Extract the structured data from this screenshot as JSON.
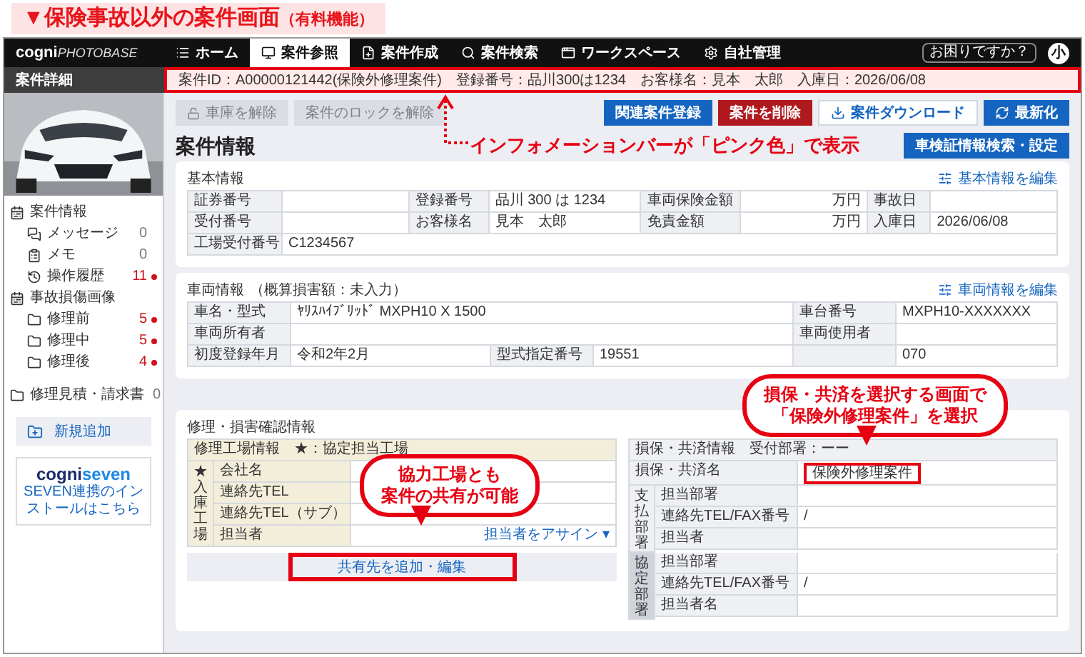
{
  "banner": {
    "title": "▼保険事故以外の案件画面",
    "note": "（有料機能）"
  },
  "header": {
    "logo_main": "cogni",
    "logo_sub": "PHOTOBASE",
    "nav": [
      {
        "label": "ホーム",
        "selected": false
      },
      {
        "label": "案件参照",
        "selected": true
      },
      {
        "label": "案件作成",
        "selected": false
      },
      {
        "label": "案件検索",
        "selected": false
      },
      {
        "label": "ワークスペース",
        "selected": false
      },
      {
        "label": "自社管理",
        "selected": false
      }
    ],
    "help_button": "お困りですか？",
    "avatar": "小"
  },
  "info_bar": {
    "text": "案件ID：A00000121442(保険外修理案件)　登録番号：品川300は1234　お客様名：見本　太郎　入庫日：2026/06/08"
  },
  "sidebar": {
    "title": "案件詳細",
    "menu": [
      {
        "label": "案件情報",
        "children": [
          {
            "label": "メッセージ",
            "count": "0",
            "alert": false
          },
          {
            "label": "メモ",
            "count": "0",
            "alert": false
          },
          {
            "label": "操作履歴",
            "count": "11",
            "alert": true
          }
        ]
      },
      {
        "label": "事故損傷画像",
        "children": [
          {
            "label": "修理前",
            "count": "5",
            "alert": true
          },
          {
            "label": "修理中",
            "count": "5",
            "alert": true
          },
          {
            "label": "修理後",
            "count": "4",
            "alert": true
          }
        ]
      },
      {
        "label": "修理見積・請求書",
        "count": "0",
        "alert": false
      }
    ],
    "add_button": "新規追加",
    "seven_logo_a": "cogni",
    "seven_logo_b": "seven",
    "seven_link": "SEVEN連携のインストールはこちら"
  },
  "toolbar": {
    "left": [
      {
        "label": "車庫を解除",
        "disabled": true
      },
      {
        "label": "案件のロックを解除",
        "disabled": true
      }
    ],
    "right": [
      {
        "label": "関連案件登録",
        "kind": "primary"
      },
      {
        "label": "案件を削除",
        "kind": "danger"
      },
      {
        "label": "案件ダウンロード",
        "kind": "outline"
      },
      {
        "label": "最新化",
        "kind": "refresh"
      }
    ]
  },
  "page_title": "案件情報",
  "title_button": "車検証情報検索・設定",
  "annotations": {
    "info_note": "インフォメーションバーが「ピンク色」で表示",
    "insurer_callout": [
      "損保・共済を選択する画面で",
      "「保険外修理案件」を選択"
    ],
    "share_callout": [
      "協力工場とも",
      "案件の共有が可能"
    ]
  },
  "basic": {
    "title": "基本情報",
    "edit_link": "基本情報を編集",
    "rows": [
      [
        {
          "label": "証券番号"
        },
        {
          "label": "登録番号",
          "value": "品川 300 は 1234"
        },
        {
          "label": "車両保険金額",
          "unit": "万円"
        },
        {
          "label": "事故日"
        }
      ],
      [
        {
          "label": "受付番号"
        },
        {
          "label": "お客様名",
          "value": "見本　太郎"
        },
        {
          "label": "免責金額",
          "unit": "万円"
        },
        {
          "label": "入庫日",
          "value": "2026/06/08"
        }
      ],
      [
        {
          "label": "工場受付番号",
          "value": "C1234567"
        }
      ]
    ]
  },
  "vehicle": {
    "title": "車両情報",
    "subtitle": "（概算損害額：未入力）",
    "edit_link": "車両情報を編集",
    "rows": [
      [
        {
          "label": "車名・型式",
          "value": "ﾔﾘｽﾊｲﾌﾞﾘｯﾄﾞ MXPH10 X 1500"
        },
        {
          "label": "車台番号",
          "value": "MXPH10-XXXXXXX"
        }
      ],
      [
        {
          "label": "車両所有者"
        },
        {
          "label": "車両使用者"
        }
      ],
      [
        {
          "label": "初度登録年月",
          "value": "令和2年2月"
        },
        {
          "label": "型式指定番号",
          "value": "19551"
        },
        {
          "value": "070"
        }
      ]
    ]
  },
  "repair": {
    "title": "修理・損害確認情報",
    "shop": {
      "title": "修理工場情報　★：協定担当工場",
      "group": "★入庫工場",
      "rows": [
        {
          "label": "会社名"
        },
        {
          "label": "連絡先TEL"
        },
        {
          "label": "連絡先TEL（サブ）"
        },
        {
          "label": "担当者",
          "link": "担当者をアサイン ▾"
        }
      ],
      "share_button": "共有先を追加・編集",
      "share_highlighted": true
    },
    "insurer": {
      "title": "損保・共済情報　受付部署：ーー",
      "name_label": "損保・共済名",
      "name_value": "保険外修理案件",
      "name_highlighted": true,
      "groups": [
        {
          "label": "支払部署",
          "rows": [
            {
              "label": "担当部署"
            },
            {
              "label": "連絡先TEL/FAX番号",
              "value": "/"
            },
            {
              "label": "担当者"
            }
          ]
        },
        {
          "label": "協定部署",
          "rows": [
            {
              "label": "担当部署"
            },
            {
              "label": "連絡先TEL/FAX番号",
              "value": "/"
            },
            {
              "label": "担当者名"
            }
          ]
        }
      ]
    }
  }
}
